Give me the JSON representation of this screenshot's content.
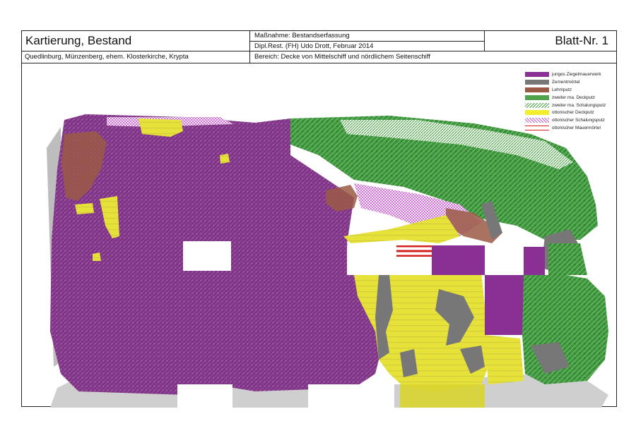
{
  "header": {
    "title": "Kartierung, Bestand",
    "location": "Quedlinburg, Münzenberg, ehem. Klosterkirche, Krypta",
    "measure": "Maßnahme: Bestandserfassung",
    "author": "Dipl.Rest. (FH) Udo Drott, Februar 2014",
    "area": "Bereich: Decke von Mittelschiff und nördlichem Seitenschiff",
    "sheet": "Blatt-Nr. 1"
  },
  "legend": {
    "items": [
      {
        "label": "junges Ziegelmauerwerk",
        "color": "#8a2f93",
        "pattern": "solid"
      },
      {
        "label": "Zementmörtel",
        "color": "#777777",
        "pattern": "solid"
      },
      {
        "label": "Lehmputz",
        "color": "#9b5a45",
        "pattern": "solid"
      },
      {
        "label": "zweiter ma. Deckputz",
        "color": "#4fa44b",
        "pattern": "solid"
      },
      {
        "label": "zweiter ma. Schalungsputz",
        "color": "#4fa44b",
        "pattern": "hatch"
      },
      {
        "label": "ottonischer Deckputz",
        "color": "#f2ee2e",
        "pattern": "solid"
      },
      {
        "label": "ottonischer Schalungsputz",
        "color": "#c25fc9",
        "pattern": "hatch"
      },
      {
        "label": "ottonischer Mauermörtel",
        "color": "#d61f1f",
        "pattern": "lines"
      }
    ]
  }
}
